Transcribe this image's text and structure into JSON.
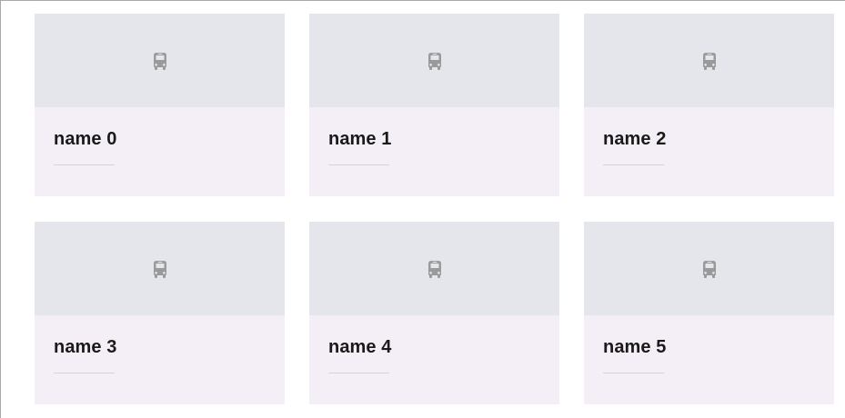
{
  "cards": [
    {
      "name": "name 0",
      "icon": "bus-icon"
    },
    {
      "name": "name 1",
      "icon": "bus-icon"
    },
    {
      "name": "name 2",
      "icon": "bus-icon"
    },
    {
      "name": "name 3",
      "icon": "bus-icon"
    },
    {
      "name": "name 4",
      "icon": "bus-icon"
    },
    {
      "name": "name 5",
      "icon": "bus-icon"
    }
  ],
  "colors": {
    "media_background": "#e5e6ec",
    "body_background": "#f4eff6",
    "icon": "#9a9a9a",
    "underline": "#d2d4da"
  }
}
